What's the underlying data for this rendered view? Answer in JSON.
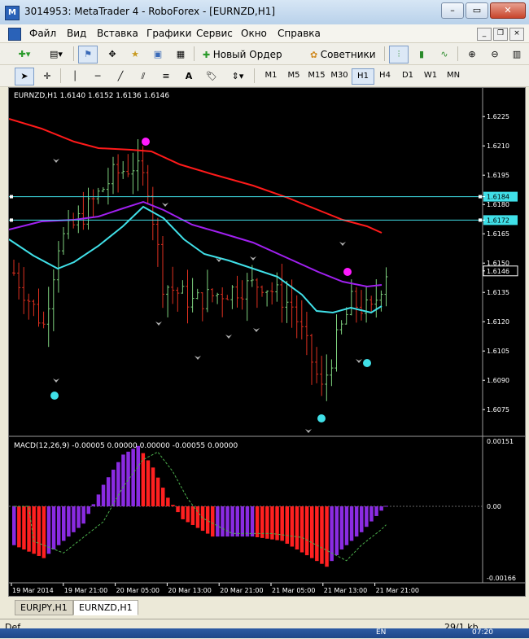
{
  "window": {
    "title": "3014953: MetaTrader 4 - RoboForex - [EURNZD,H1]"
  },
  "menu": {
    "items": [
      "Файл",
      "Вид",
      "Вставка",
      "Графики",
      "Сервис",
      "Окно",
      "Справка"
    ]
  },
  "toolbar": {
    "new_order_label": "Новый Ордер",
    "advisors_label": "Советники"
  },
  "timeframes": [
    "M1",
    "M5",
    "M15",
    "M30",
    "H1",
    "H4",
    "D1",
    "W1",
    "MN"
  ],
  "active_timeframe": "H1",
  "chart": {
    "header": "EURNZD,H1  1.6140 1.6152 1.6136 1.6146",
    "price_labels": [
      "1.6225",
      "1.6210",
      "1.6195",
      "1.6184",
      "1.6180",
      "1.6172",
      "1.6165",
      "1.6150",
      "1.6146",
      "1.6135",
      "1.6120",
      "1.6105",
      "1.6090",
      "1.6075"
    ],
    "hline_levels": [
      "1.6184",
      "1.6172"
    ],
    "current_price": "1.6146",
    "time_labels": [
      "19 Mar 2014",
      "19 Mar 21:00",
      "20 Mar 05:00",
      "20 Mar 13:00",
      "20 Mar 21:00",
      "21 Mar 05:00",
      "21 Mar 13:00",
      "21 Mar 21:00"
    ]
  },
  "macd": {
    "header": "MACD(12,26,9) -0.00005 0.00000 0.00000 -0.00055 0.00000",
    "labels": [
      "0.00151",
      "0.00",
      "-0.00166"
    ]
  },
  "tabs": [
    "EURJPY,H1",
    "EURNZD,H1"
  ],
  "active_tab": "EURNZD,H1",
  "status": {
    "left": "Def",
    "right": "29/1 kb",
    "lang": "EN",
    "time": "07:20"
  },
  "colors": {
    "bull": "#7fd27f",
    "bear": "#e03020",
    "ma_red": "#ff1a1a",
    "ma_purple": "#a020f0",
    "ma_cyan": "#40e0e8",
    "macd_pos": "#8a2be2",
    "macd_neg": "#ff2020",
    "signal": "#4caf4c"
  }
}
